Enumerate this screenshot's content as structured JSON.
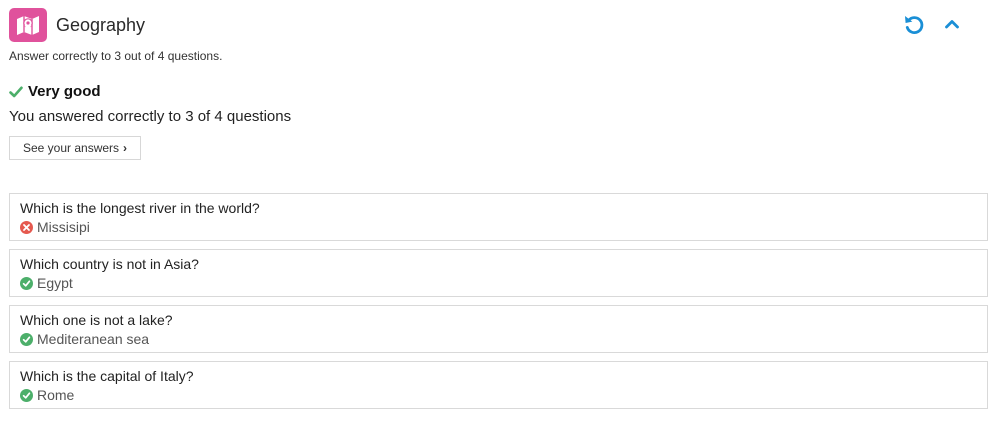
{
  "header": {
    "title": "Geography",
    "app_icon": "map-icon",
    "accent_color": "#e0529c",
    "action_color": "#1a8fd6",
    "actions": [
      "retry-icon",
      "collapse-icon"
    ]
  },
  "subtitle": "Answer correctly to 3 out of 4 questions.",
  "result": {
    "heading": "Very good",
    "text": "You answered correctly to 3 of 4 questions",
    "success_color": "#4caf6a"
  },
  "see_answers_label": "See your answers",
  "questions": [
    {
      "question": "Which is the longest river in the world?",
      "answer": "Missisipi",
      "status": "wrong"
    },
    {
      "question": "Which country is not in Asia?",
      "answer": "Egypt",
      "status": "correct"
    },
    {
      "question": "Which one is not a lake?",
      "answer": "Mediteranean sea",
      "status": "correct"
    },
    {
      "question": "Which is the capital of Italy?",
      "answer": "Rome",
      "status": "correct"
    }
  ],
  "status_colors": {
    "wrong": "#e5594f",
    "correct": "#4caf6a"
  }
}
